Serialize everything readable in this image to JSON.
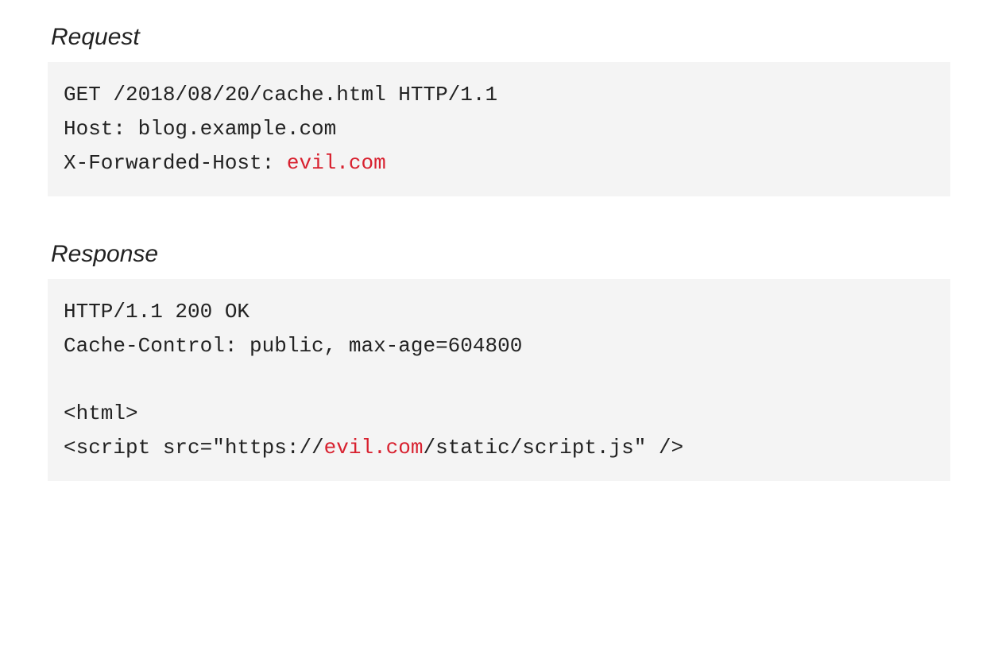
{
  "request": {
    "title": "Request",
    "line1": "GET /2018/08/20/cache.html HTTP/1.1",
    "line2": "Host: blog.example.com",
    "line3_prefix": "X-Forwarded-Host: ",
    "line3_highlight": "evil.com"
  },
  "response": {
    "title": "Response",
    "line1": "HTTP/1.1 200 OK",
    "line2": "Cache-Control: public, max-age=604800",
    "line3": "",
    "line4": "<html>",
    "line5_prefix": "<script src=\"https://",
    "line5_highlight": "evil.com",
    "line5_suffix": "/static/script.js\" />"
  }
}
